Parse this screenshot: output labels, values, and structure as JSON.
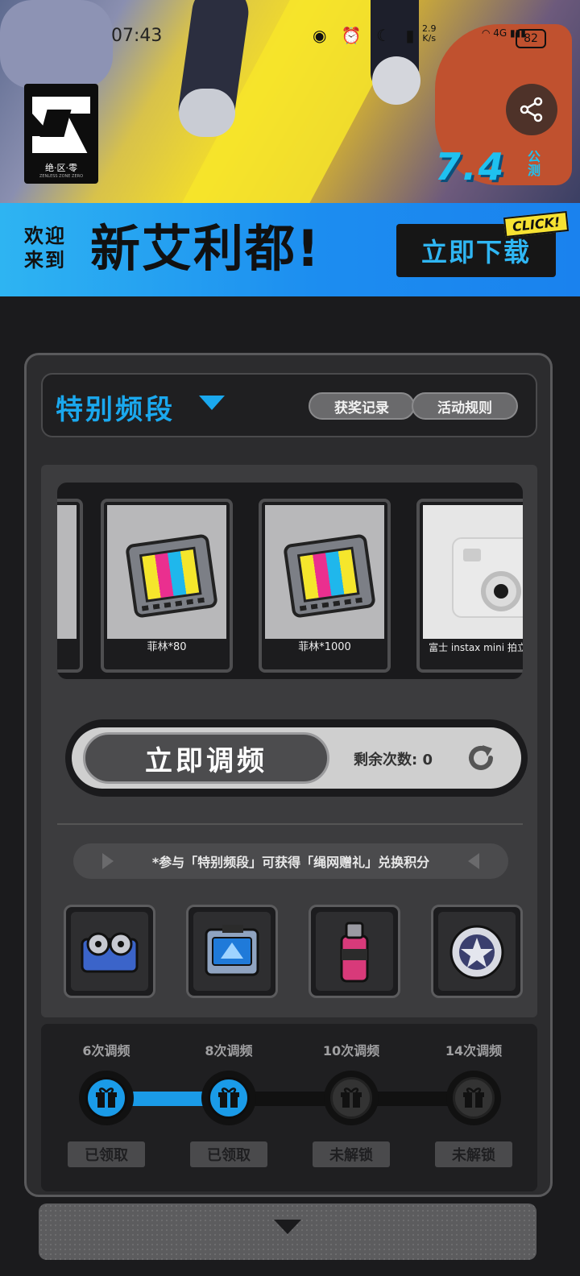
{
  "status_bar": {
    "time": "07:43",
    "speed_value": "2.9",
    "speed_unit": "K/s",
    "network": "4G",
    "battery": "82"
  },
  "banner": {
    "logo_text": "绝·区·零",
    "logo_sub": "ZENLESS ZONE ZERO",
    "logo_tm": "TM",
    "date": "7.4",
    "date_tag": "公测",
    "welcome_small": "欢迎来到",
    "welcome_big": "新艾利都!",
    "download_label": "立即下载",
    "click_tag": "CLICK!"
  },
  "header": {
    "title": "特别频段",
    "records_label": "获奖记录",
    "rules_label": "活动规则"
  },
  "carousel": {
    "items": [
      {
        "label": "菲林*80",
        "icon": "film-icon"
      },
      {
        "label": "菲林*1000",
        "icon": "film-icon"
      },
      {
        "label": "富士 instax mini 拍立得",
        "icon": "camera-icon"
      }
    ]
  },
  "tune": {
    "button_label": "立即调频",
    "remain_label": "剩余次数:",
    "remain_count": "0"
  },
  "notice": "*参与「特别频段」可获得「绳网赠礼」兑换积分",
  "rewards": [
    {
      "icon": "tape-reel-icon"
    },
    {
      "icon": "data-disk-icon"
    },
    {
      "icon": "spray-can-icon"
    },
    {
      "icon": "coin-icon"
    }
  ],
  "progress": {
    "steps": [
      {
        "label": "6次调频",
        "status": "已领取",
        "state": "done"
      },
      {
        "label": "8次调频",
        "status": "已领取",
        "state": "done"
      },
      {
        "label": "10次调频",
        "status": "未解锁",
        "state": "locked"
      },
      {
        "label": "14次调频",
        "status": "未解锁",
        "state": "locked"
      }
    ]
  },
  "colors": {
    "accent_blue": "#1aa8ee",
    "panel_bg": "#2c2c2e",
    "yellow": "#f2dc2b"
  }
}
